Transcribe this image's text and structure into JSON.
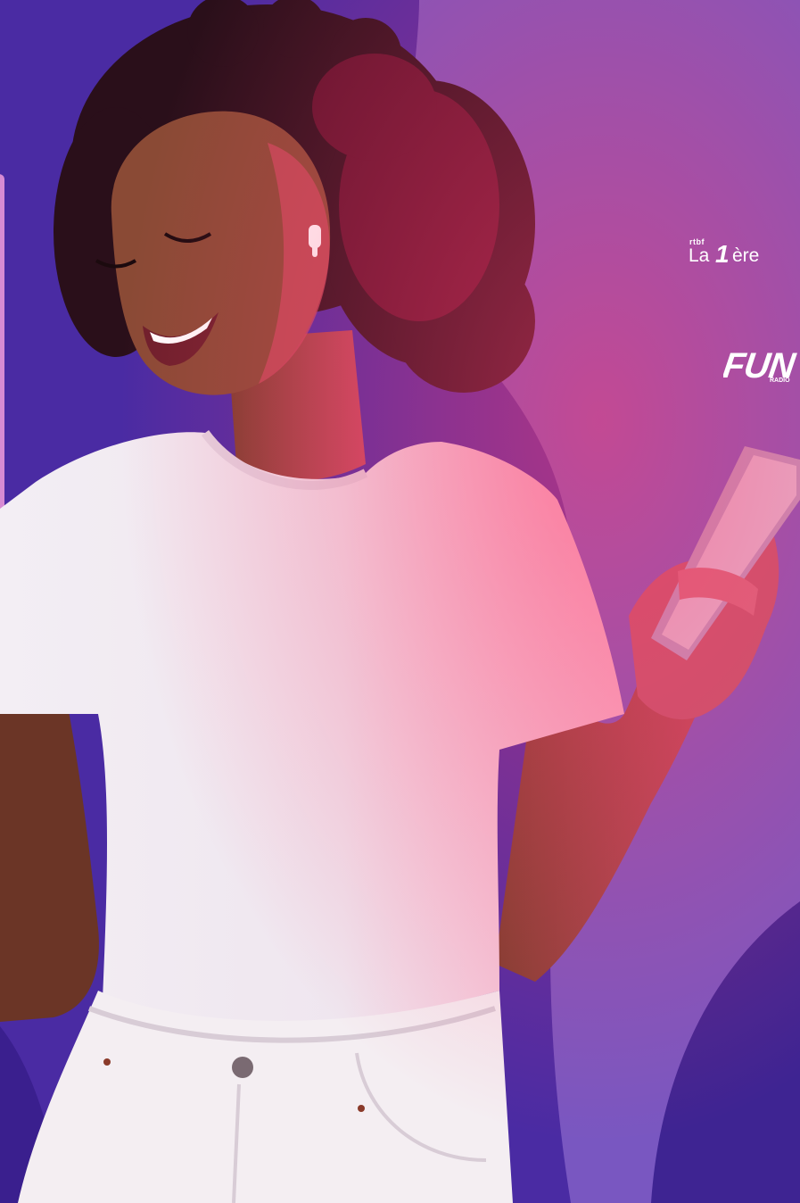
{
  "colors": {
    "background": "#4a2ba3",
    "accent_purple": "#7e5cc4",
    "deep_purple": "#3e2492",
    "edge_panel": "#d78bd3",
    "shirt": "#f3eef4",
    "skin": "#8a4a35",
    "hair": "#2a0f1a",
    "neon_glow": "#ff3e6e"
  },
  "logos": {
    "la_premiere": {
      "brand": "rtbf",
      "text_a": "La",
      "number": "1",
      "text_b": "ère"
    },
    "fun_radio": {
      "text": "FUN",
      "subtext": "RADIO"
    }
  },
  "photo": {
    "subject": "woman-listening-with-earbuds",
    "icon": "smartphone-icon"
  }
}
